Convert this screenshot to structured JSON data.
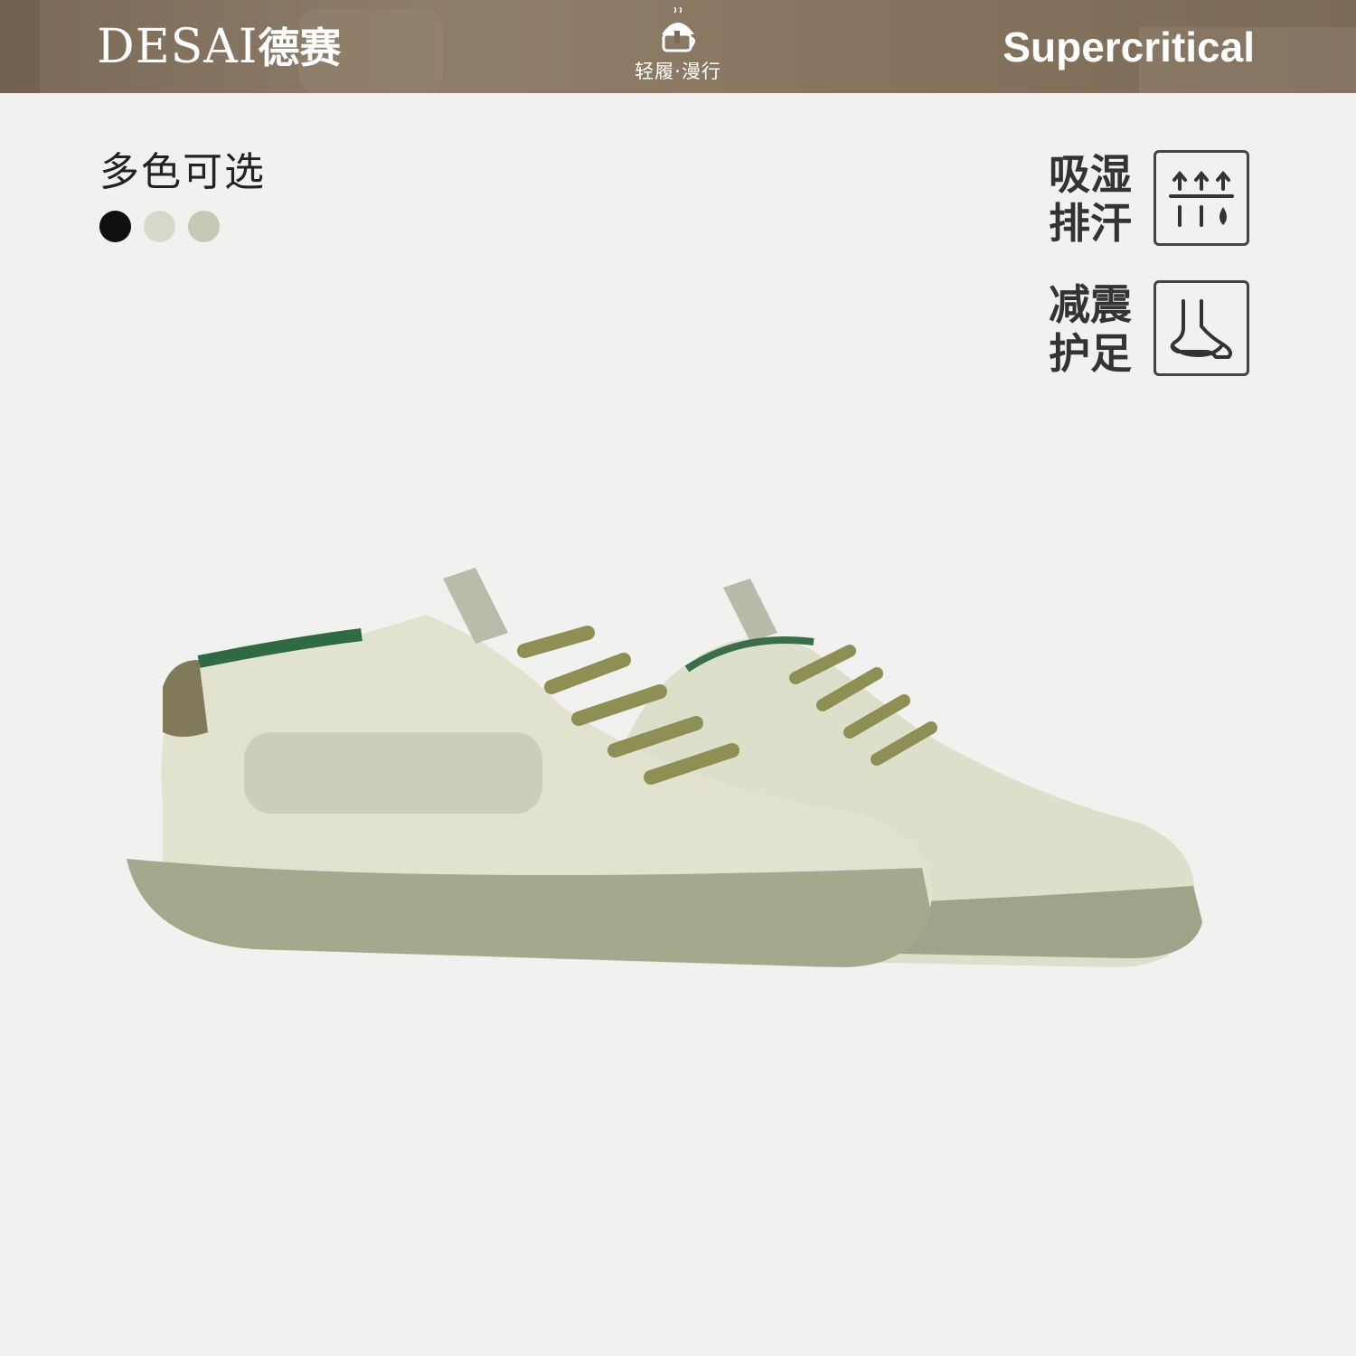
{
  "header": {
    "logo_latin": "DESAI",
    "logo_chinese": "德赛",
    "center_icon": "mushroom-cup-icon",
    "slogan": "轻履·漫行",
    "brand_right": "Supercritical"
  },
  "colors": {
    "label": "多色可选",
    "swatches": [
      "#0f0f0f",
      "#d9d8cc",
      "#c6c9b3"
    ]
  },
  "features": [
    {
      "line1": "吸湿",
      "line2": "排汗",
      "icon": "moisture-wicking-icon"
    },
    {
      "line1": "减震",
      "line2": "护足",
      "icon": "cushioned-foot-icon"
    }
  ],
  "product": {
    "image": "pair-of-sage-green-sneakers"
  }
}
